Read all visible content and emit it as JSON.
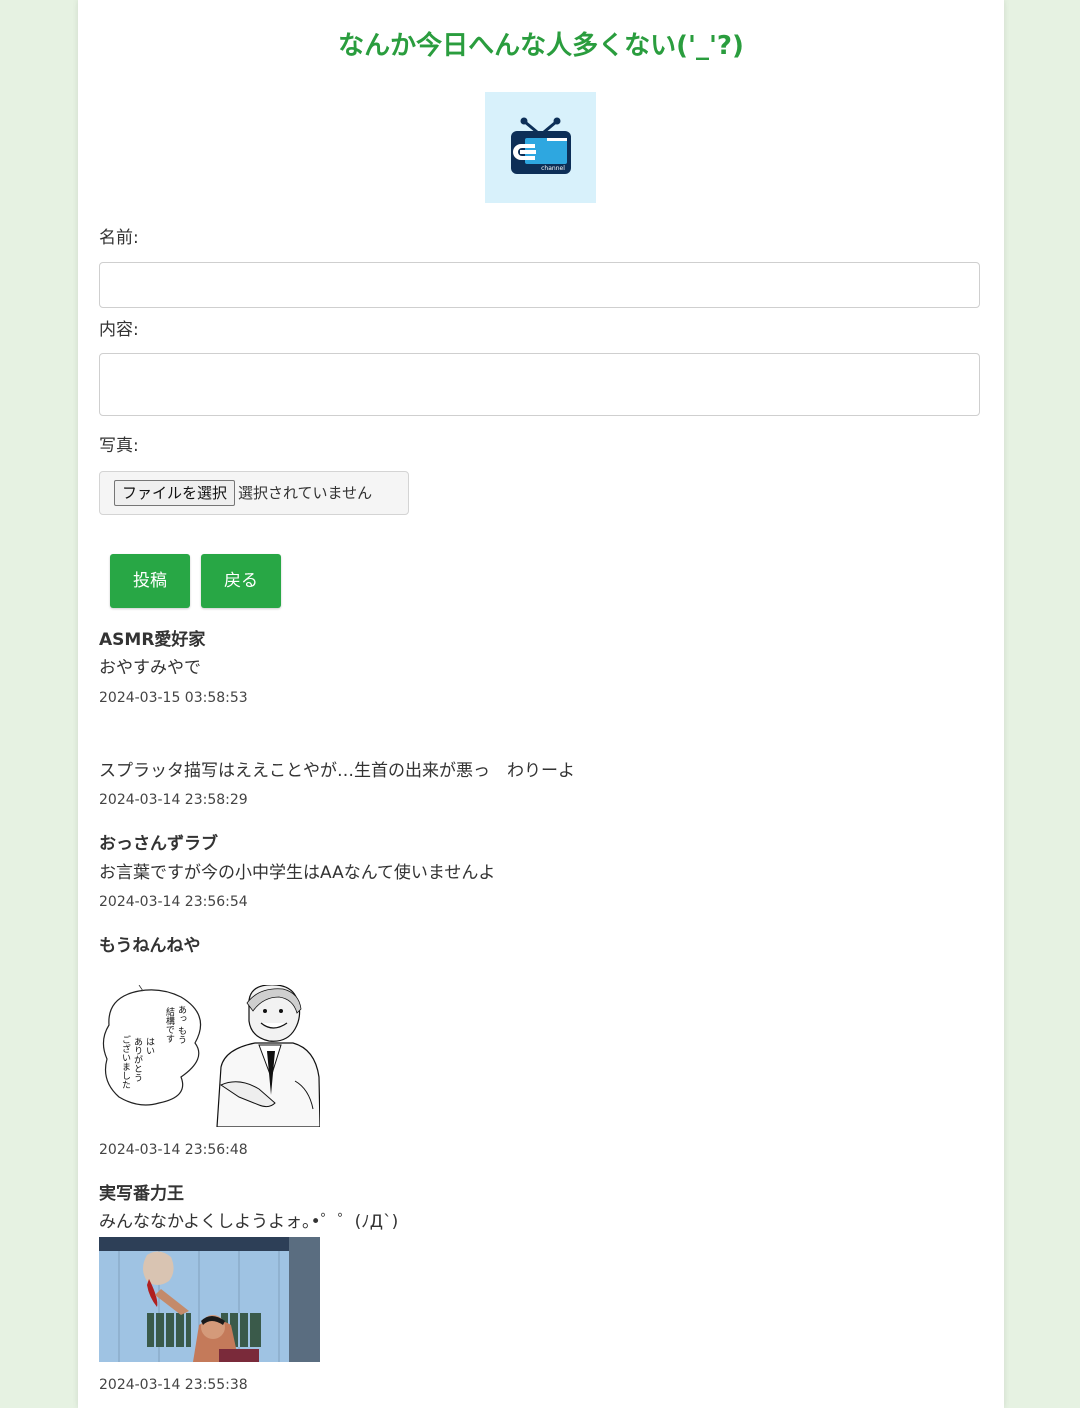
{
  "page": {
    "title": "なんか今日へんな人多くない('_'?)",
    "logo": {
      "icon": "tv-channel-logo-icon",
      "text": "channel"
    },
    "colors": {
      "accent": "#2a9d3e",
      "button": "#28a745",
      "background": "#e6f2e2",
      "logo_bg": "#d8f1fb"
    }
  },
  "form": {
    "name_label": "名前:",
    "name_value": "",
    "content_label": "内容:",
    "content_value": "",
    "photo_label": "写真:",
    "file_button_label": "ファイルを選択",
    "file_status": "選択されていません",
    "submit_label": "投稿",
    "back_label": "戻る"
  },
  "posts": [
    {
      "name": "ASMR愛好家",
      "content": "おやすみやで",
      "timestamp": "2024-03-15 03:58:53"
    },
    {
      "name": "",
      "content": "スプラッタ描写はええことやが…生首の出来が悪っ　わりーよ",
      "timestamp": "2024-03-14 23:58:29"
    },
    {
      "name": "おっさんずラブ",
      "content": "お言葉ですが今の小中学生はAAなんて使いませんよ",
      "timestamp": "2024-03-14 23:56:54"
    },
    {
      "name": "もうねんねや",
      "content": "",
      "image": {
        "icon": "manga-panel-image",
        "speech_text": "あっ もう結構です はい ありがとうございました"
      },
      "timestamp": "2024-03-14 23:56:48"
    },
    {
      "name": "実写番力王",
      "content": "みんななかよくしようよォ｡•゜゜(ﾉД`)",
      "image": {
        "icon": "movie-still-image"
      },
      "timestamp": "2024-03-14 23:55:38"
    }
  ]
}
